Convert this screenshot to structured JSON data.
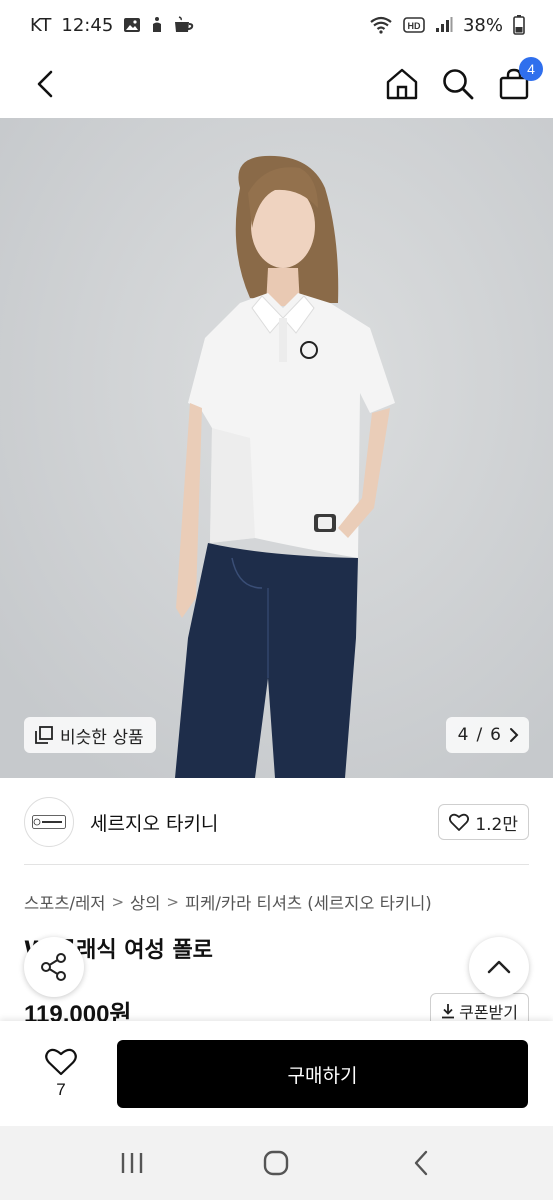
{
  "status_bar": {
    "carrier": "KT",
    "time": "12:45",
    "battery": "38%"
  },
  "header": {
    "cart_count": "4",
    "icons": [
      "back-arrow-icon",
      "home-icon",
      "search-icon",
      "shopping-bag-icon"
    ]
  },
  "gallery": {
    "similar_label": "비슷한 상품",
    "page_current": "4",
    "page_separator": "/",
    "page_total": "6"
  },
  "brand": {
    "logo_text": "Sergio Tacchini",
    "name": "세르지오 타키니",
    "likes": "1.2만"
  },
  "breadcrumb": [
    "스포츠/레저",
    "상의",
    "피케/카라 티셔츠 (세르지오 타키니)"
  ],
  "product": {
    "title": "W 클래식 여성 폴로",
    "price": "119,000원",
    "coupon_label": "쿠폰받기"
  },
  "purchase_bar": {
    "wish_count": "7",
    "buy_label": "구매하기"
  },
  "colors": {
    "badge": "#2f6fed",
    "buy_button": "#000000",
    "background": "#ffffff"
  }
}
